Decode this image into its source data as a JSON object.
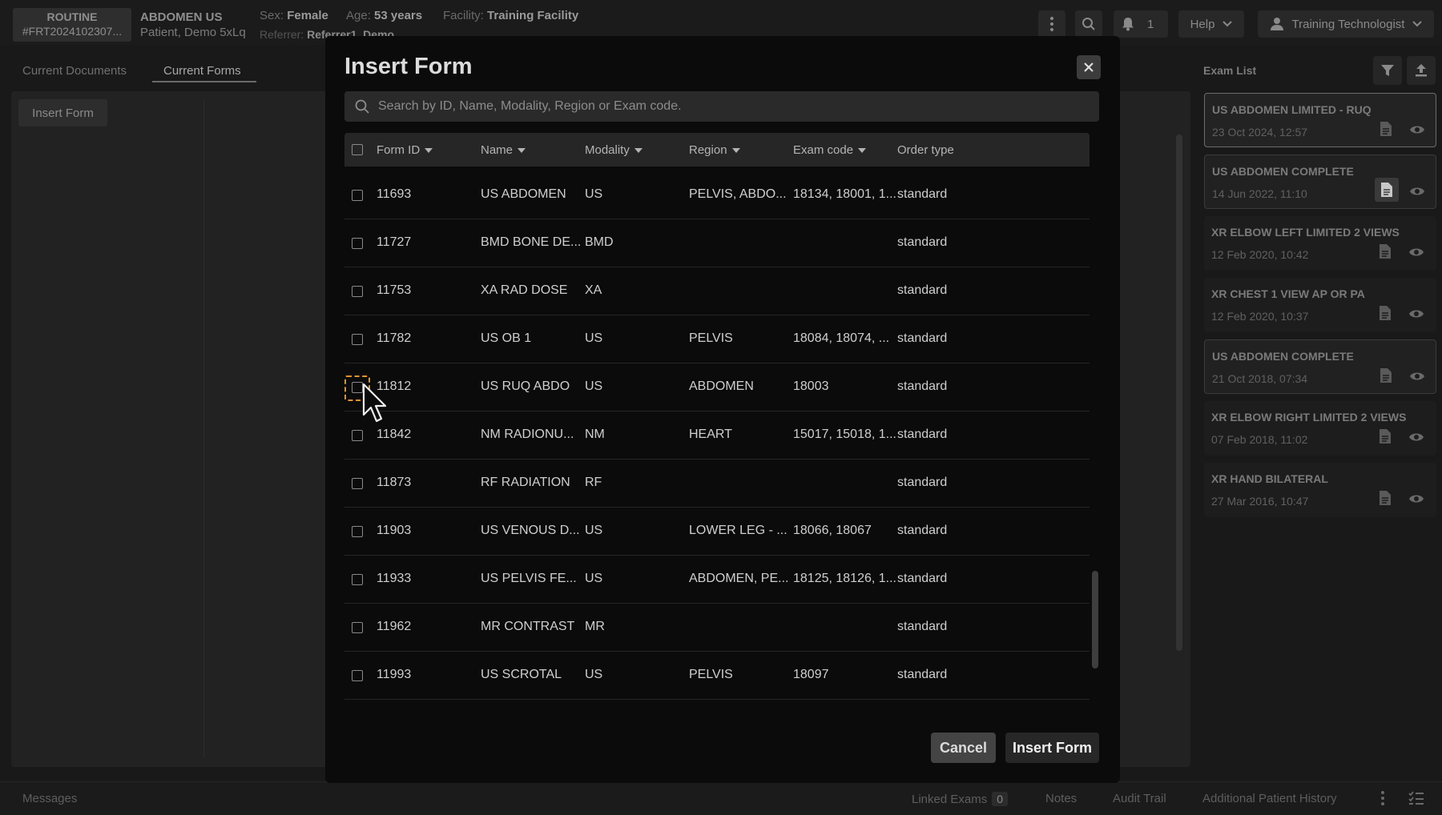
{
  "header": {
    "priority": "ROUTINE",
    "accession": "#FRT2024102307...",
    "exam_title": "ABDOMEN US",
    "patient_name": "Patient, Demo 5xLq",
    "sex_label": "Sex:",
    "sex_value": "Female",
    "age_label": "Age:",
    "age_value": "53 years",
    "facility_label": "Facility:",
    "facility_value": "Training Facility",
    "referrer_label": "Referrer:",
    "referrer_value": "Referrer1, Demo",
    "notification_count": "1",
    "help_label": "Help",
    "user_name": "Training Technologist"
  },
  "left_panel": {
    "tabs": [
      {
        "label": "Current Documents",
        "active": false
      },
      {
        "label": "Current Forms",
        "active": true
      }
    ],
    "insert_form_label": "Insert Form"
  },
  "exam_list": {
    "title": "Exam List",
    "items": [
      {
        "title": "US ABDOMEN LIMITED - RUQ",
        "date": "23 Oct 2024, 12:57",
        "state": "selected"
      },
      {
        "title": "US ABDOMEN COMPLETE",
        "date": "14 Jun 2022, 11:10",
        "state": "boxed"
      },
      {
        "title": "XR ELBOW LEFT LIMITED 2 VIEWS",
        "date": "12 Feb 2020, 10:42",
        "state": "plain"
      },
      {
        "title": "XR CHEST 1 VIEW AP OR PA",
        "date": "12 Feb 2020, 10:37",
        "state": "plain"
      },
      {
        "title": "US ABDOMEN COMPLETE",
        "date": "21 Oct 2018, 07:34",
        "state": "boxed"
      },
      {
        "title": "XR ELBOW RIGHT LIMITED 2 VIEWS",
        "date": "07 Feb 2018, 11:02",
        "state": "plain"
      },
      {
        "title": "XR HAND BILATERAL",
        "date": "27 Mar 2016, 10:47",
        "state": "plain"
      }
    ]
  },
  "bottom_bar": {
    "messages": "Messages",
    "linked_exams": "Linked Exams",
    "linked_exams_count": "0",
    "notes": "Notes",
    "audit_trail": "Audit Trail",
    "additional_history": "Additional Patient History"
  },
  "modal": {
    "title": "Insert Form",
    "search_placeholder": "Search by ID, Name, Modality, Region or Exam code.",
    "columns": [
      "Form ID",
      "Name",
      "Modality",
      "Region",
      "Exam code",
      "Order type"
    ],
    "rows": [
      {
        "id": "11693",
        "name": "US ABDOMEN",
        "modality": "US",
        "region": "PELVIS, ABDO...",
        "exam_code": "18134, 18001, 1...",
        "order_type": "standard"
      },
      {
        "id": "11727",
        "name": "BMD BONE DE...",
        "modality": "BMD",
        "region": "",
        "exam_code": "",
        "order_type": "standard"
      },
      {
        "id": "11753",
        "name": "XA RAD DOSE",
        "modality": "XA",
        "region": "",
        "exam_code": "",
        "order_type": "standard"
      },
      {
        "id": "11782",
        "name": "US OB 1",
        "modality": "US",
        "region": "PELVIS",
        "exam_code": "18084, 18074, ...",
        "order_type": "standard"
      },
      {
        "id": "11812",
        "name": "US RUQ ABDO",
        "modality": "US",
        "region": "ABDOMEN",
        "exam_code": "18003",
        "order_type": "standard"
      },
      {
        "id": "11842",
        "name": "NM RADIONU...",
        "modality": "NM",
        "region": "HEART",
        "exam_code": "15017, 15018, 1...",
        "order_type": "standard"
      },
      {
        "id": "11873",
        "name": "RF RADIATION",
        "modality": "RF",
        "region": "",
        "exam_code": "",
        "order_type": "standard"
      },
      {
        "id": "11903",
        "name": "US VENOUS D...",
        "modality": "US",
        "region": "LOWER LEG - ...",
        "exam_code": "18066, 18067",
        "order_type": "standard"
      },
      {
        "id": "11933",
        "name": "US PELVIS FE...",
        "modality": "US",
        "region": "ABDOMEN, PE...",
        "exam_code": "18125, 18126, 1...",
        "order_type": "standard"
      },
      {
        "id": "11962",
        "name": "MR CONTRAST",
        "modality": "MR",
        "region": "",
        "exam_code": "",
        "order_type": "standard"
      },
      {
        "id": "11993",
        "name": "US SCROTAL",
        "modality": "US",
        "region": "PELVIS",
        "exam_code": "18097",
        "order_type": "standard"
      }
    ],
    "focused_row_index": 4,
    "cancel_label": "Cancel",
    "insert_label": "Insert Form"
  },
  "colors": {
    "focus_ring": "#e1932f",
    "modal_bg": "#0b0b0b",
    "page_bg": "#191919"
  }
}
